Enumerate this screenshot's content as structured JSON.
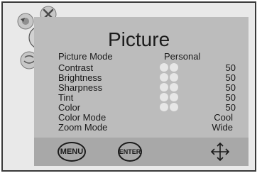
{
  "osd": {
    "title": "Picture",
    "items": [
      {
        "label": "Picture Mode",
        "value": "Personal",
        "knobs": false
      },
      {
        "label": "Contrast",
        "value": "50",
        "knobs": true
      },
      {
        "label": "Brightness",
        "value": "50",
        "knobs": true
      },
      {
        "label": "Sharpness",
        "value": "50",
        "knobs": true
      },
      {
        "label": "Tint",
        "value": "50",
        "knobs": true
      },
      {
        "label": "Color",
        "value": "50",
        "knobs": true
      },
      {
        "label": "Color Mode",
        "value": "Cool",
        "knobs": false
      },
      {
        "label": "Zoom Mode",
        "value": "Wide",
        "knobs": false
      }
    ],
    "footer": {
      "menu_label": "MENU",
      "enter_label": "ENTER",
      "move_icon": "four-way-arrow-icon"
    },
    "side_icons": [
      "settings-icon",
      "tools-icon",
      "picture-icon",
      "globe-icon"
    ],
    "colors": {
      "panel": "#bcbcbc",
      "footer": "#a8a8a8",
      "background": "#e9e9e9"
    }
  }
}
